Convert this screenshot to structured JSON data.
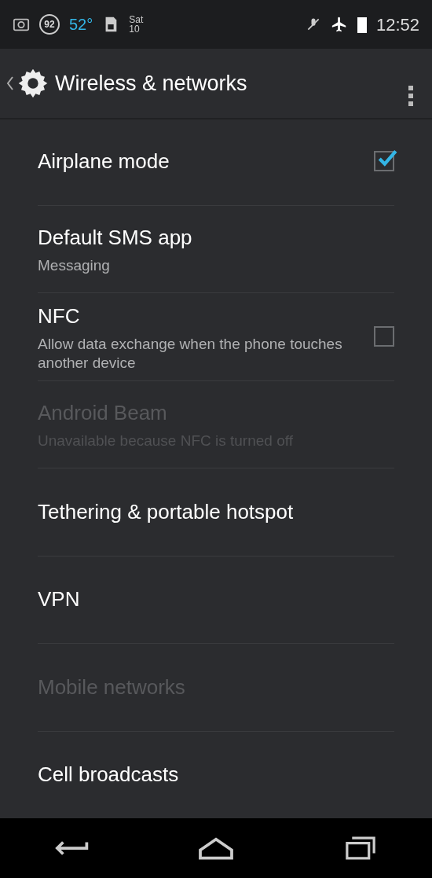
{
  "status_bar": {
    "badge": "92",
    "temperature": "52°",
    "day": "Sat",
    "date": "10",
    "time": "12:52"
  },
  "action_bar": {
    "title": "Wireless & networks"
  },
  "settings": [
    {
      "kind": "checkbox",
      "title": "Airplane mode",
      "checked": true,
      "disabled": false
    },
    {
      "kind": "plain",
      "title": "Default SMS app",
      "summary": "Messaging",
      "disabled": false
    },
    {
      "kind": "checkbox",
      "title": "NFC",
      "summary": "Allow data exchange when the phone touches another device",
      "checked": false,
      "disabled": false
    },
    {
      "kind": "plain",
      "title": "Android Beam",
      "summary": "Unavailable because NFC is turned off",
      "disabled": true
    },
    {
      "kind": "plain",
      "title": "Tethering & portable hotspot",
      "disabled": false
    },
    {
      "kind": "plain",
      "title": "VPN",
      "disabled": false
    },
    {
      "kind": "plain",
      "title": "Mobile networks",
      "disabled": true
    },
    {
      "kind": "plain",
      "title": "Cell broadcasts",
      "disabled": false
    }
  ]
}
